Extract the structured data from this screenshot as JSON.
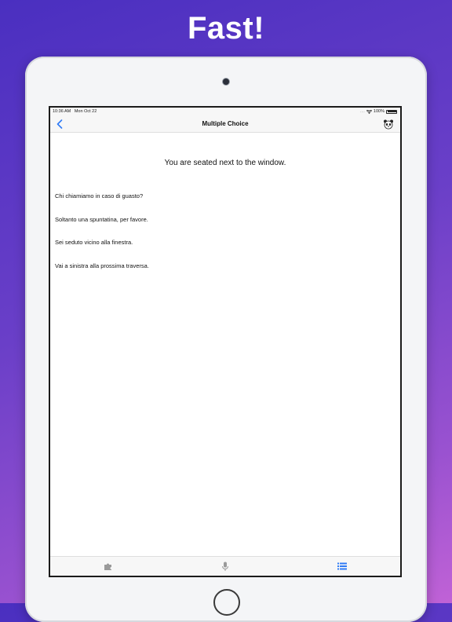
{
  "headline": "Fast!",
  "status_bar": {
    "time": "10:36 AM",
    "date": "Mon Oct 22",
    "dots": "....",
    "battery": "100%"
  },
  "nav": {
    "title": "Multiple Choice"
  },
  "prompt": "You are seated next to the window.",
  "choices": [
    "Chi chiamiamo in caso di guasto?",
    "Soltanto una spuntatina, per favore.",
    "Sei seduto vicino alla finestra.",
    "Vai a sinistra alla prossima traversa."
  ],
  "tabs": [
    {
      "name": "puzzle-icon",
      "active": false
    },
    {
      "name": "microphone-icon",
      "active": false
    },
    {
      "name": "list-icon",
      "active": true
    }
  ],
  "colors": {
    "accent": "#2f7bf6",
    "inactive_icon": "#9a9a9a",
    "gradient_start": "#4a2fc0",
    "gradient_end": "#c062d6"
  }
}
